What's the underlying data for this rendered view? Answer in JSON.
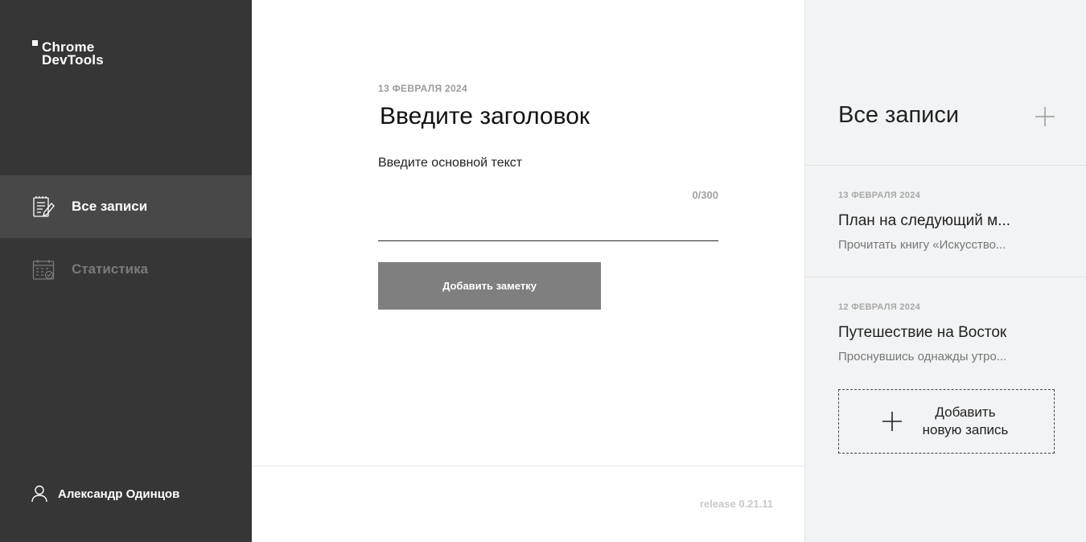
{
  "app": {
    "logo_line1": "Chrome",
    "logo_line2": "DevTools"
  },
  "sidebar": {
    "items": [
      {
        "label": "Все записи",
        "icon": "notes-icon",
        "active": true
      },
      {
        "label": "Статистика",
        "icon": "calendar-stats-icon",
        "active": false
      }
    ],
    "user_name": "Александр Одинцов"
  },
  "editor": {
    "date": "13 ФЕВРАЛЯ 2024",
    "title_placeholder": "Введите заголовок",
    "body_placeholder": "Введите основной текст",
    "counter": "0/300",
    "add_button_label": "Добавить заметку",
    "release": "release 0.21.11"
  },
  "notes_panel": {
    "title": "Все записи",
    "notes": [
      {
        "date": "13 ФЕВРАЛЯ 2024",
        "title": "План на следующий м...",
        "excerpt": "Прочитать книгу «Искусство..."
      },
      {
        "date": "12 ФЕВРАЛЯ 2024",
        "title": "Путешествие на Восток",
        "excerpt": "Проснувшись однажды утро..."
      }
    ],
    "add_new_line1": "Добавить",
    "add_new_line2": "новую запись"
  },
  "colors": {
    "sidebar_bg": "#363636",
    "sidebar_active_bg": "#484848",
    "button_bg": "#7f7f7f",
    "panel_bg": "#f2f3f4"
  }
}
